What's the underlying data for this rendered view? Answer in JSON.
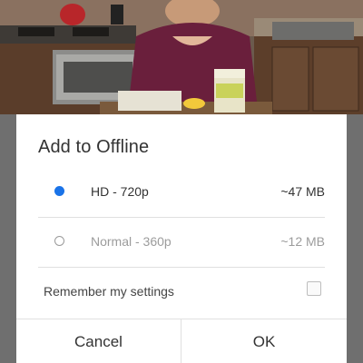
{
  "dialog": {
    "title": "Add to Offline",
    "options": [
      {
        "label": "HD - 720p",
        "size": "~47 MB",
        "selected": true
      },
      {
        "label": "Normal - 360p",
        "size": "~12 MB",
        "selected": false
      }
    ],
    "remember_label": "Remember my settings",
    "remember_checked": false,
    "cancel_label": "Cancel",
    "ok_label": "OK"
  },
  "colors": {
    "accent": "#1a73e8"
  }
}
